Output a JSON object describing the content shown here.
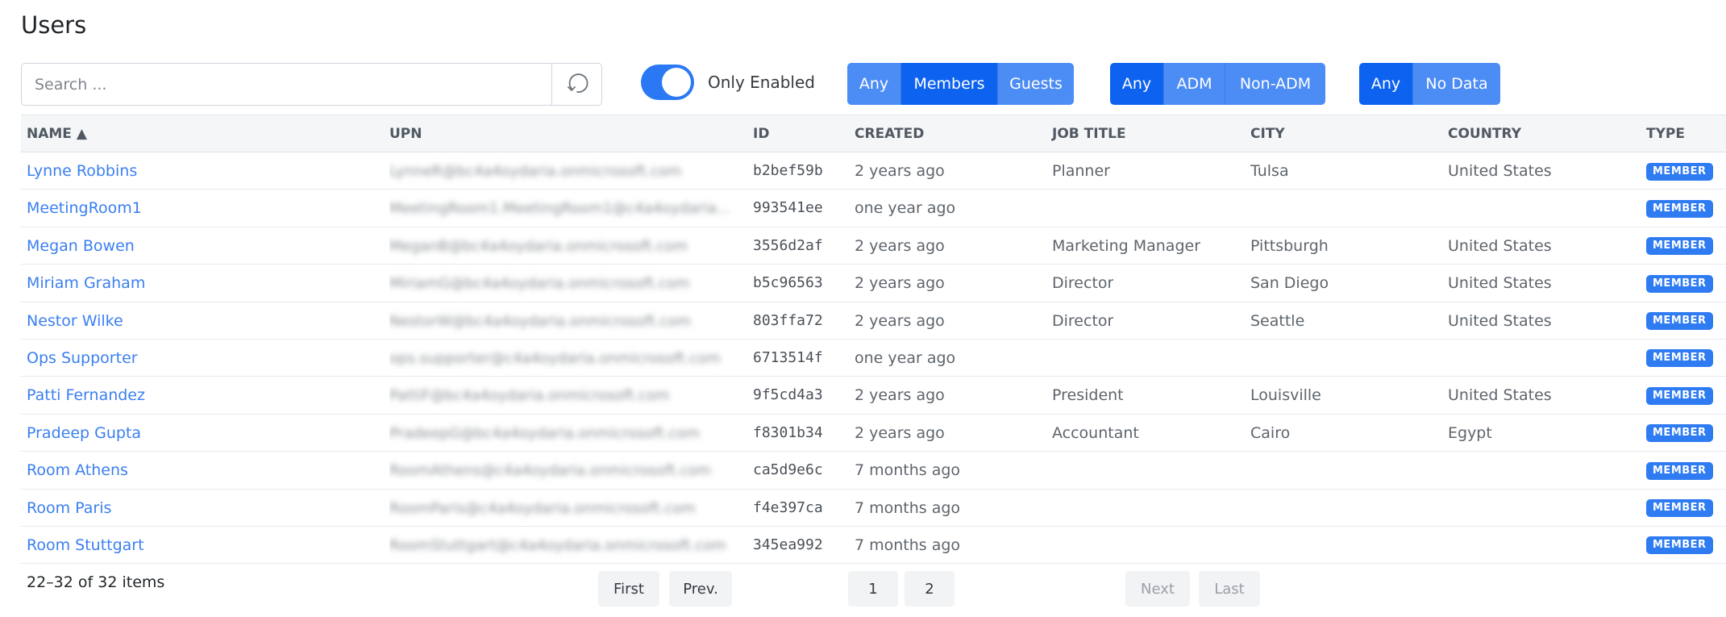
{
  "page_title": "Users",
  "search": {
    "placeholder": "Search ...",
    "value": "",
    "button_icon": "refresh-icon"
  },
  "toggle": {
    "label": "Only Enabled",
    "checked": true
  },
  "filters": {
    "type": [
      {
        "label": "Any",
        "active": false
      },
      {
        "label": "Members",
        "active": true
      },
      {
        "label": "Guests",
        "active": false
      }
    ],
    "adm": [
      {
        "label": "Any",
        "active": true
      },
      {
        "label": "ADM",
        "active": false
      },
      {
        "label": "Non-ADM",
        "active": false
      }
    ],
    "data": [
      {
        "label": "Any",
        "active": true
      },
      {
        "label": "No Data",
        "active": false
      }
    ]
  },
  "colors": {
    "accent": "#0d62f0",
    "accent_light": "#4c8cf5",
    "link": "#3a7ff0",
    "badge": "#2e7bf2"
  },
  "table": {
    "headers": {
      "name": "NAME ▲",
      "upn": "UPN",
      "id": "ID",
      "created": "CREATED",
      "job_title": "JOB TITLE",
      "city": "CITY",
      "country": "COUNTRY",
      "type": "TYPE"
    },
    "rows": [
      {
        "name": "Lynne Robbins",
        "upn": "LynneR@bc4a4oydaria.onmicrosoft.com",
        "id": "b2bef59b",
        "created": "2 years ago",
        "job_title": "Planner",
        "city": "Tulsa",
        "country": "United States",
        "type": "MEMBER"
      },
      {
        "name": "MeetingRoom1",
        "upn": "MeetingRoom1.MeetingRoom1@c4a4oydaria...",
        "id": "993541ee",
        "created": "one year ago",
        "job_title": "",
        "city": "",
        "country": "",
        "type": "MEMBER"
      },
      {
        "name": "Megan Bowen",
        "upn": "MeganB@bc4a4oydaria.onmicrosoft.com",
        "id": "3556d2af",
        "created": "2 years ago",
        "job_title": "Marketing Manager",
        "city": "Pittsburgh",
        "country": "United States",
        "type": "MEMBER"
      },
      {
        "name": "Miriam Graham",
        "upn": "MiriamG@bc4a4oydaria.onmicrosoft.com",
        "id": "b5c96563",
        "created": "2 years ago",
        "job_title": "Director",
        "city": "San Diego",
        "country": "United States",
        "type": "MEMBER"
      },
      {
        "name": "Nestor Wilke",
        "upn": "NestorW@bc4a4oydaria.onmicrosoft.com",
        "id": "803ffa72",
        "created": "2 years ago",
        "job_title": "Director",
        "city": "Seattle",
        "country": "United States",
        "type": "MEMBER"
      },
      {
        "name": "Ops Supporter",
        "upn": "ops.supporter@c4a4oydaria.onmicrosoft.com",
        "id": "6713514f",
        "created": "one year ago",
        "job_title": "",
        "city": "",
        "country": "",
        "type": "MEMBER"
      },
      {
        "name": "Patti Fernandez",
        "upn": "PattiF@bc4a4oydaria.onmicrosoft.com",
        "id": "9f5cd4a3",
        "created": "2 years ago",
        "job_title": "President",
        "city": "Louisville",
        "country": "United States",
        "type": "MEMBER"
      },
      {
        "name": "Pradeep Gupta",
        "upn": "PradeepG@bc4a4oydaria.onmicrosoft.com",
        "id": "f8301b34",
        "created": "2 years ago",
        "job_title": "Accountant",
        "city": "Cairo",
        "country": "Egypt",
        "type": "MEMBER"
      },
      {
        "name": "Room Athens",
        "upn": "RoomAthens@c4a4oydaria.onmicrosoft.com",
        "id": "ca5d9e6c",
        "created": "7 months ago",
        "job_title": "",
        "city": "",
        "country": "",
        "type": "MEMBER"
      },
      {
        "name": "Room Paris",
        "upn": "RoomParis@c4a4oydaria.onmicrosoft.com",
        "id": "f4e397ca",
        "created": "7 months ago",
        "job_title": "",
        "city": "",
        "country": "",
        "type": "MEMBER"
      },
      {
        "name": "Room Stuttgart",
        "upn": "RoomStuttgart@c4a4oydaria.onmicrosoft.com",
        "id": "345ea992",
        "created": "7 months ago",
        "job_title": "",
        "city": "",
        "country": "",
        "type": "MEMBER"
      }
    ]
  },
  "pagination": {
    "summary": "22–32 of 32 items",
    "first": "First",
    "prev": "Prev.",
    "pages": [
      "1",
      "2"
    ],
    "current_page": "2",
    "next": "Next",
    "last": "Last"
  }
}
